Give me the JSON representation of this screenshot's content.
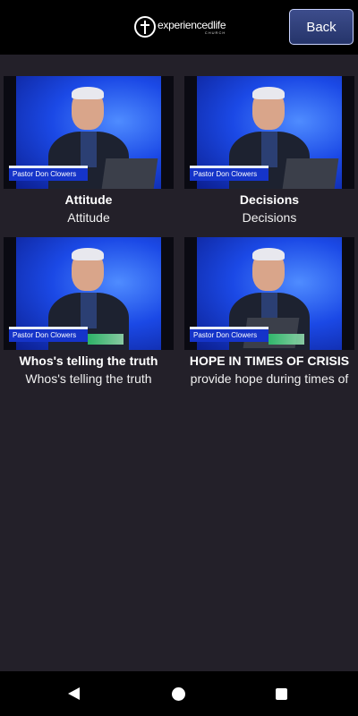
{
  "header": {
    "logo_text": "experiencedlife",
    "logo_subtext": "CHURCH",
    "back_label": "Back"
  },
  "videos": [
    {
      "title": "Attitude",
      "subtitle": "Attitude",
      "lower_third": "Pastor Don Clowers"
    },
    {
      "title": "Decisions",
      "subtitle": "Decisions",
      "lower_third": "Pastor Don Clowers"
    },
    {
      "title": "Whos's telling the truth",
      "subtitle": "Whos's telling the truth",
      "lower_third": "Pastor Don Clowers"
    },
    {
      "title": "HOPE IN TIMES OF CRISIS",
      "subtitle": "provide hope during times of",
      "lower_third": "Pastor Don Clowers"
    }
  ],
  "navbar": {
    "icons": [
      "back-triangle-icon",
      "home-circle-icon",
      "recents-square-icon"
    ]
  }
}
